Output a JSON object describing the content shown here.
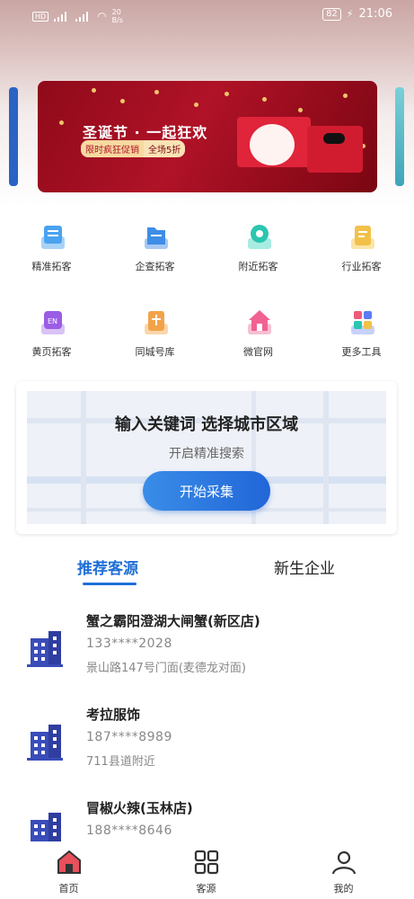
{
  "status_bar": {
    "network_label": "20\nB/s",
    "battery": "82",
    "time": "21:06"
  },
  "banner": {
    "title": "圣诞节 · 一起狂欢",
    "tag_left": "限时疯狂促销",
    "tag_right": "全场5折"
  },
  "tools": [
    {
      "label": "精准拓客",
      "icon": "list-stack-icon",
      "color": "#4aa3f0"
    },
    {
      "label": "企查拓客",
      "icon": "folder-search-icon",
      "color": "#3f8de6"
    },
    {
      "label": "附近拓客",
      "icon": "location-search-icon",
      "color": "#2bc6b0"
    },
    {
      "label": "行业拓客",
      "icon": "document-icon",
      "color": "#f2c14a"
    },
    {
      "label": "黄页拓客",
      "icon": "en-book-icon",
      "color": "#9b5de5"
    },
    {
      "label": "同城号库",
      "icon": "phone-book-icon",
      "color": "#f2a34a"
    },
    {
      "label": "微官网",
      "icon": "home-website-icon",
      "color": "#f06292"
    },
    {
      "label": "更多工具",
      "icon": "apps-icon",
      "color": "#5b7cf6"
    }
  ],
  "search_card": {
    "title": "输入关键词  选择城市区域",
    "subtitle": "开启精准搜索",
    "button": "开始采集"
  },
  "tabs": [
    {
      "label": "推荐客源",
      "active": true
    },
    {
      "label": "新生企业",
      "active": false
    }
  ],
  "leads": [
    {
      "name": "蟹之霸阳澄湖大闸蟹(新区店)",
      "phone": "133****2028",
      "address": "景山路147号门面(麦德龙对面)"
    },
    {
      "name": "考拉服饰",
      "phone": "187****8989",
      "address": "711县道附近"
    },
    {
      "name": "冒椒火辣(玉林店)",
      "phone": "188****8646",
      "address": ""
    }
  ],
  "bottom_nav": [
    {
      "label": "首页",
      "icon": "home-icon",
      "active": true
    },
    {
      "label": "客源",
      "icon": "grid-icon",
      "active": false
    },
    {
      "label": "我的",
      "icon": "user-icon",
      "active": false
    }
  ],
  "colors": {
    "accent": "#1f6fd6",
    "banner_red": "#b01227",
    "building_blue": "#3a4cb8"
  }
}
